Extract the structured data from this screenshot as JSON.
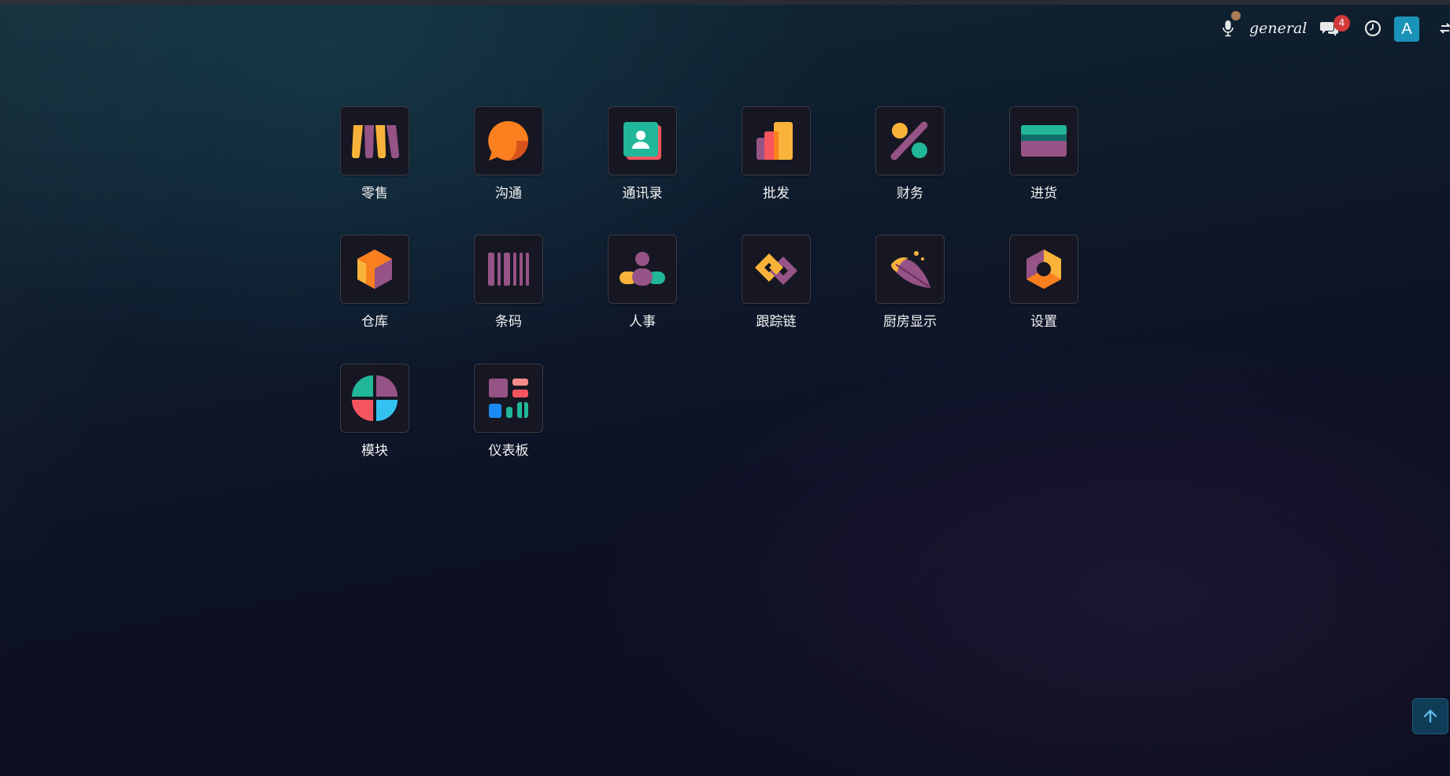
{
  "navbar": {
    "company_name": "general",
    "messages_badge": "4",
    "user_initial": "A",
    "icons": [
      "microphone-icon",
      "chat-icon",
      "clock-icon",
      "toggle-icon"
    ]
  },
  "apps": [
    {
      "label": "零售",
      "icon": "storefront-icon"
    },
    {
      "label": "沟通",
      "icon": "chat-bubble-icon"
    },
    {
      "label": "通讯录",
      "icon": "contact-card-icon"
    },
    {
      "label": "批发",
      "icon": "bar-stack-icon"
    },
    {
      "label": "财务",
      "icon": "percent-icon"
    },
    {
      "label": "进货",
      "icon": "credit-card-icon"
    },
    {
      "label": "仓库",
      "icon": "box-icon"
    },
    {
      "label": "条码",
      "icon": "barcode-icon"
    },
    {
      "label": "人事",
      "icon": "people-icon"
    },
    {
      "label": "跟踪链",
      "icon": "chain-link-icon"
    },
    {
      "label": "厨房显示",
      "icon": "leaf-icon"
    },
    {
      "label": "设置",
      "icon": "hex-gear-icon"
    },
    {
      "label": "模块",
      "icon": "quad-circle-icon"
    },
    {
      "label": "仪表板",
      "icon": "dashboard-icon"
    }
  ],
  "colors": {
    "tile_bg": "#161722",
    "tile_border": "#3a3c48",
    "badge": "#d33a3a",
    "avatar": "#1a93b8",
    "yellow": "#f9b33a",
    "purple": "#955386",
    "teal": "#21b799",
    "orange": "#f97f1f",
    "red": "#f5555f",
    "blue": "#1a8bf2"
  }
}
